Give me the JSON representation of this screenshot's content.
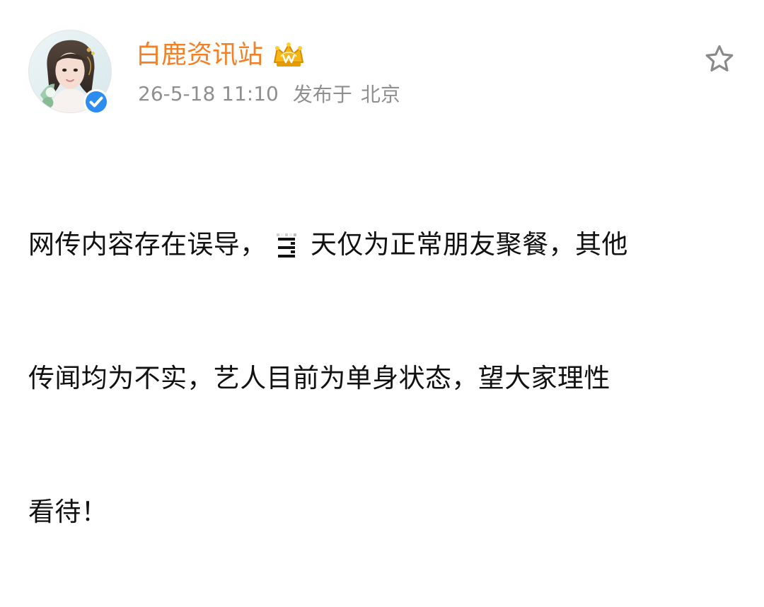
{
  "post": {
    "author": {
      "name": "白鹿资讯站",
      "avatar_description": "profile photo",
      "verified_icon": "verified-check-icon",
      "vip_icon": "golden-crown-vip-icon"
    },
    "meta": {
      "timestamp": "26-5-18 11:10",
      "source_label": "发布于",
      "location": "北京"
    },
    "actions": {
      "favorite_icon": "star-outline-icon"
    },
    "body": {
      "lines": [
        {
          "before_redaction": "网传内容存在误导，",
          "after_redaction": "天仅为正常朋友聚餐，其他"
        },
        {
          "text": "传闻均为不实，艺人目前为单身状态，望大家理性"
        },
        {
          "text": "看待！"
        }
      ]
    }
  },
  "colors": {
    "author_name": "#f47f25",
    "meta_text": "#8f8f8f",
    "body_text": "#111111",
    "verified_blue": "#2d8cf0",
    "star_stroke": "#8a8a8a"
  }
}
